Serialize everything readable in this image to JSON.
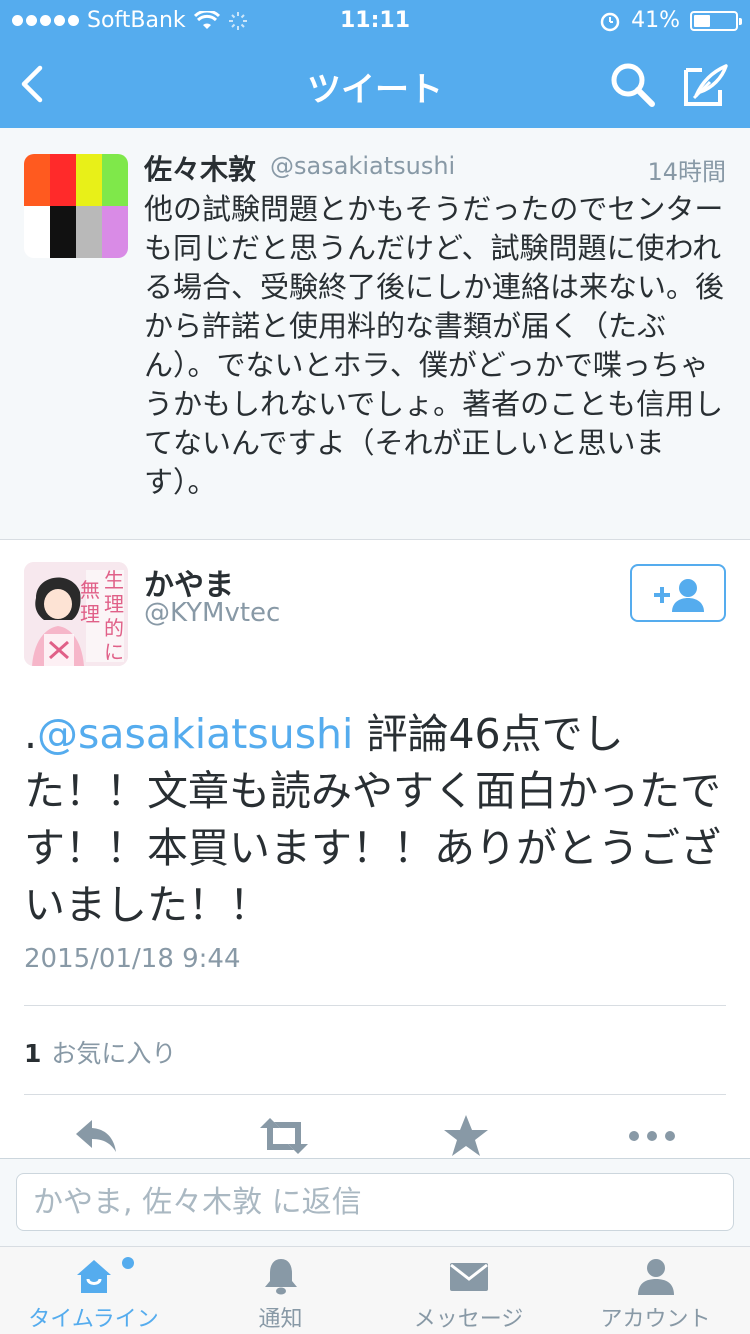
{
  "status_bar": {
    "carrier": "SoftBank",
    "time": "11:11",
    "battery": "41%"
  },
  "nav": {
    "title": "ツイート"
  },
  "parent_tweet": {
    "name": "佐々木敦",
    "handle": "@sasakiatsushi",
    "time": "14時間",
    "text": "他の試験問題とかもそうだったのでセンターも同じだと思うんだけど、試験問題に使われる場合、受験終了後にしか連絡は来ない。後から許諾と使用料的な書類が届く（たぶん）。でないとホラ、僕がどっかで喋っちゃうかもしれないでしょ。著者のことも信用してないんですよ（それが正しいと思います）。"
  },
  "main_tweet": {
    "name": "かやま",
    "handle": "@KYMvtec",
    "avatar_text": [
      "無理",
      "生理的に"
    ],
    "text_prefix": ".",
    "mention": "@sasakiatsushi",
    "text_body": " 評論46点でした！！文章も読みやすく面白かったです！！本買います！！ありがとうございました！！",
    "date": "2015/01/18 9:44",
    "fav_count": "1",
    "fav_label": "お気に入り"
  },
  "reply": {
    "placeholder": "かやま, 佐々木敦 に返信"
  },
  "tabs": [
    {
      "label": "タイムライン",
      "icon": "home-icon"
    },
    {
      "label": "通知",
      "icon": "bell-icon"
    },
    {
      "label": "メッセージ",
      "icon": "envelope-icon"
    },
    {
      "label": "アカウント",
      "icon": "person-icon"
    }
  ],
  "colors": {
    "accent": "#55acee",
    "text": "#292f33",
    "muted": "#8899a6"
  }
}
